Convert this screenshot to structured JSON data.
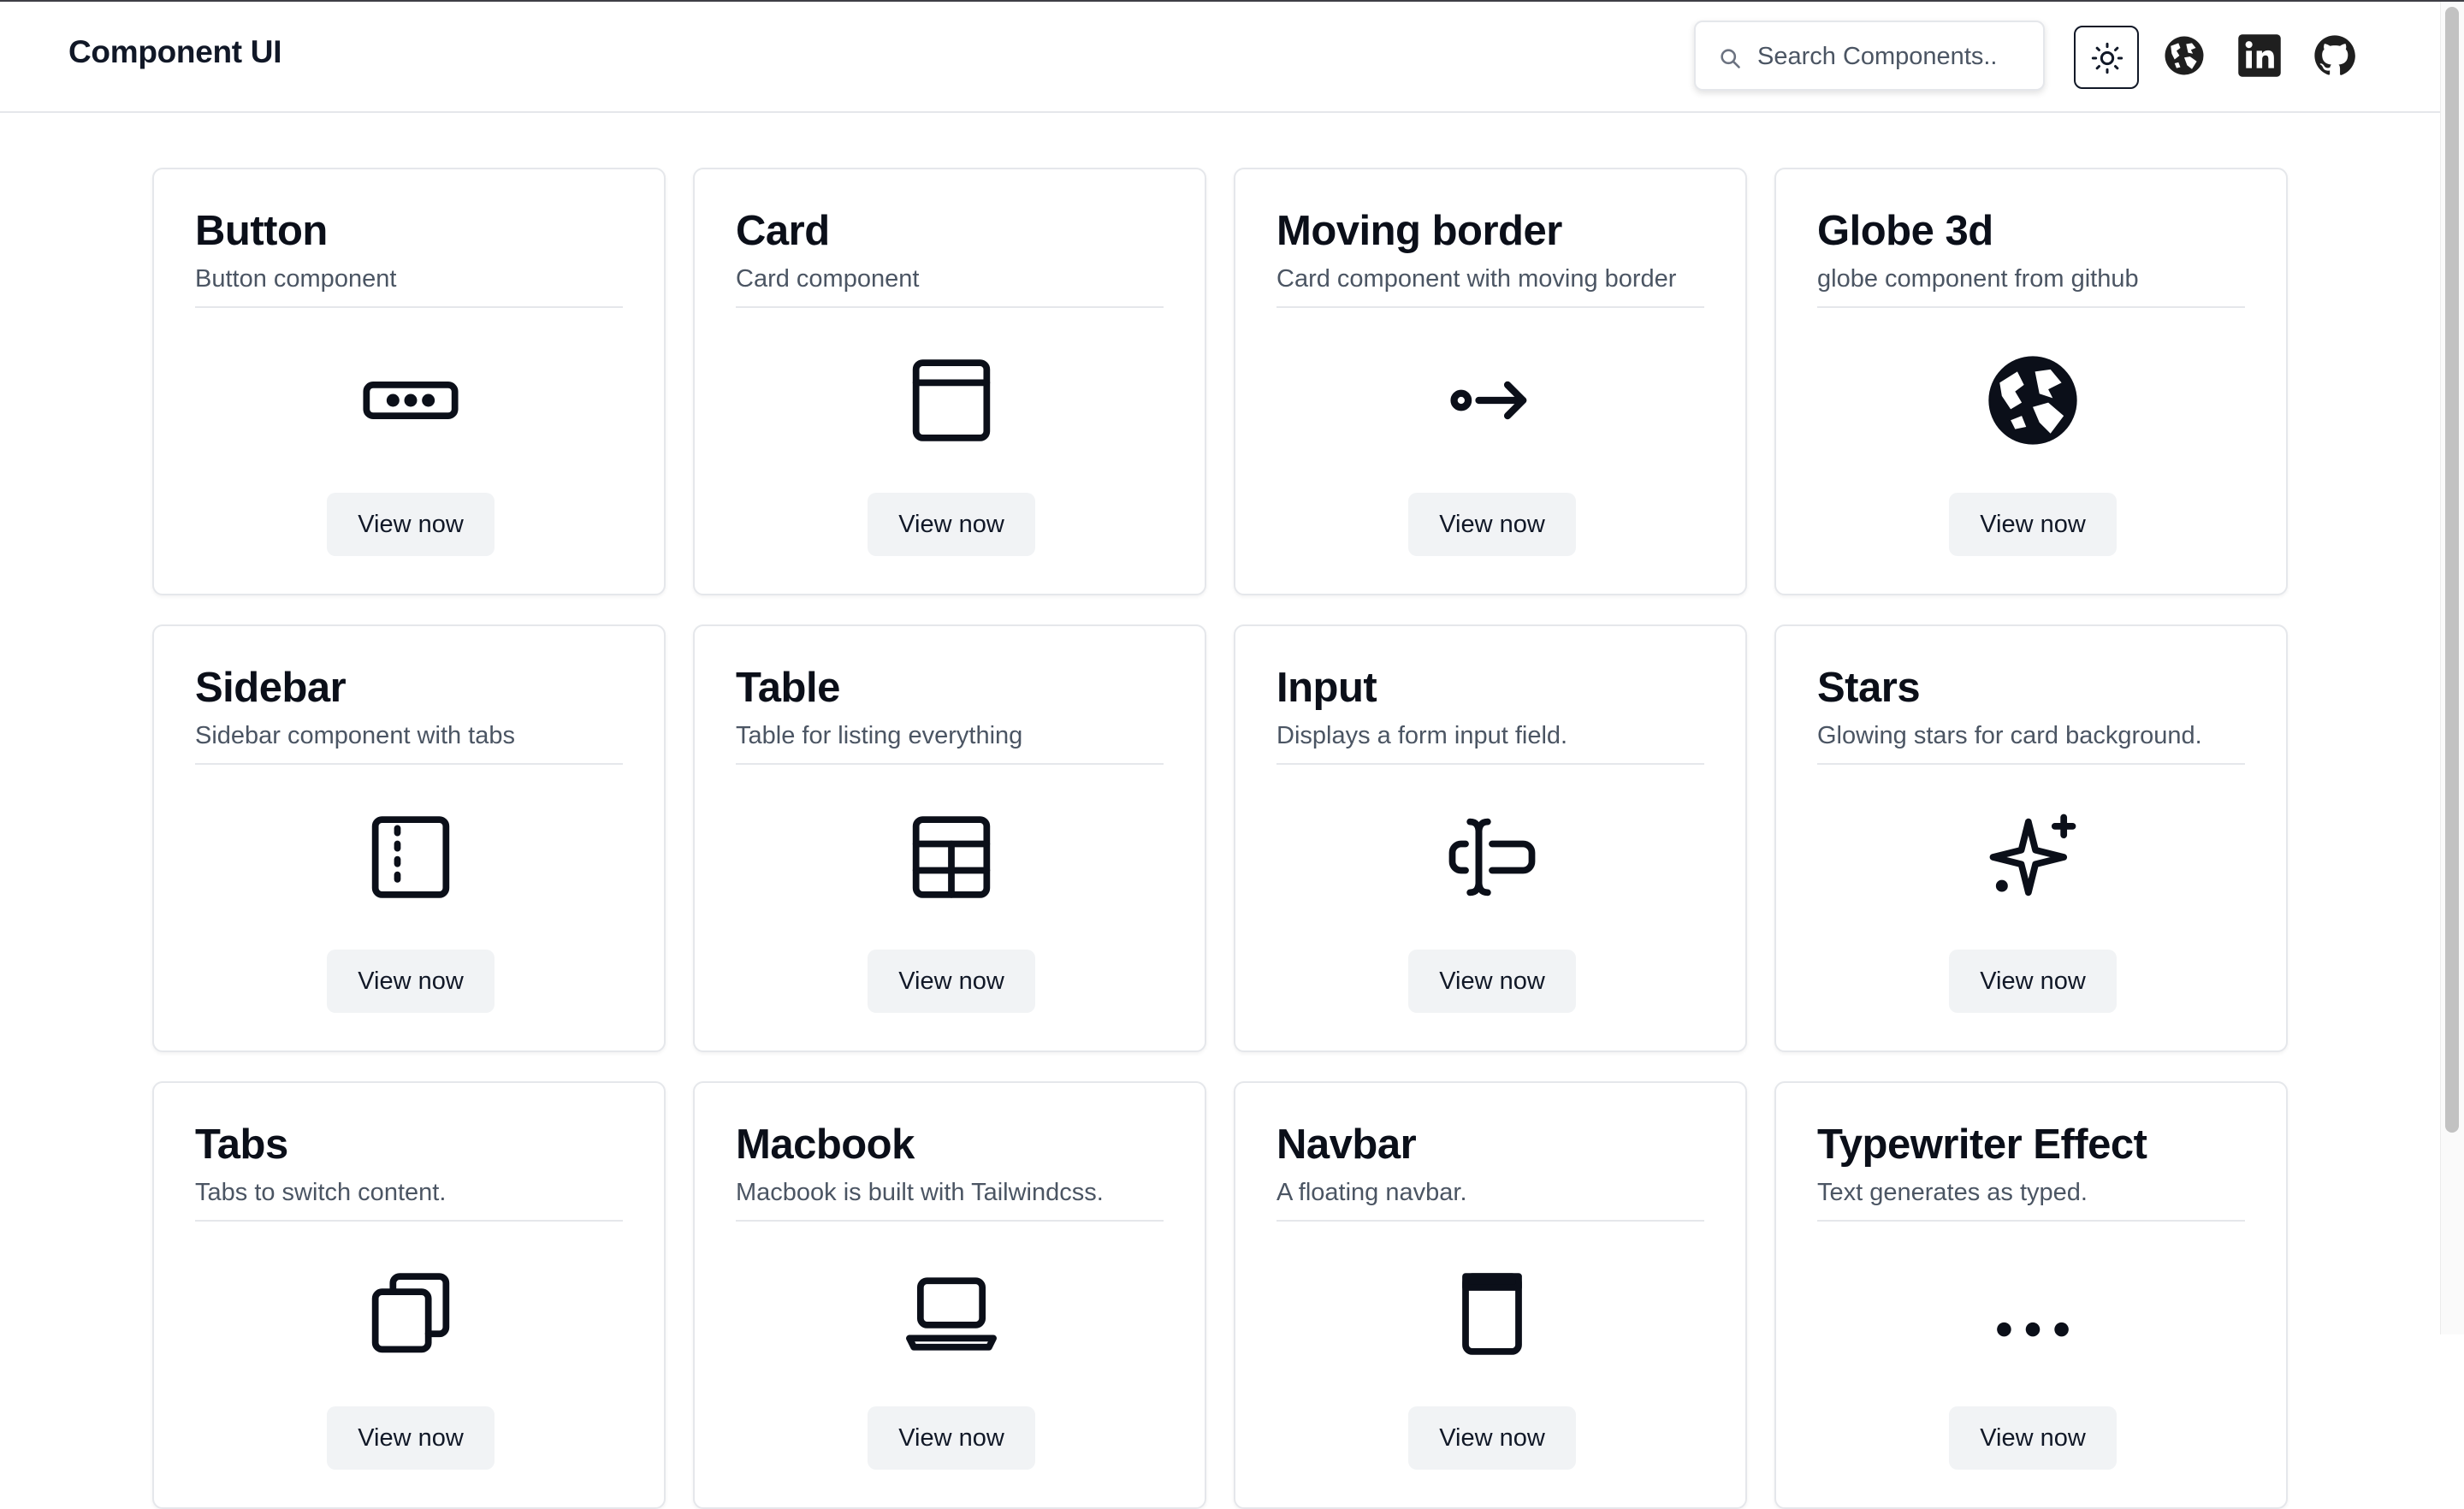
{
  "header": {
    "brand": "Component UI",
    "search_placeholder": "Search Components..",
    "theme_toggle": "sun-icon",
    "links": [
      "globe-icon",
      "linkedin-icon",
      "github-icon"
    ]
  },
  "cards": [
    {
      "title": "Button",
      "desc": "Button component",
      "icon": "button-icon",
      "cta": "View now"
    },
    {
      "title": "Card",
      "desc": "Card component",
      "icon": "card-icon",
      "cta": "View now"
    },
    {
      "title": "Moving border",
      "desc": "Card component with moving border",
      "icon": "arrow-icon",
      "cta": "View now"
    },
    {
      "title": "Globe 3d",
      "desc": "globe component from github",
      "icon": "globe-icon",
      "cta": "View now"
    },
    {
      "title": "Sidebar",
      "desc": "Sidebar component with tabs",
      "icon": "sidebar-icon",
      "cta": "View now"
    },
    {
      "title": "Table",
      "desc": "Table for listing everything",
      "icon": "table-icon",
      "cta": "View now"
    },
    {
      "title": "Input",
      "desc": "Displays a form input field.",
      "icon": "text-cursor-input-icon",
      "cta": "View now"
    },
    {
      "title": "Stars",
      "desc": "Glowing stars for card background.",
      "icon": "sparkles-icon",
      "cta": "View now"
    },
    {
      "title": "Tabs",
      "desc": "Tabs to switch content.",
      "icon": "tabs-icon",
      "cta": "View now"
    },
    {
      "title": "Macbook",
      "desc": "Macbook is built with Tailwindcss.",
      "icon": "laptop-icon",
      "cta": "View now"
    },
    {
      "title": "Navbar",
      "desc": "A floating navbar.",
      "icon": "navbar-icon",
      "cta": "View now"
    },
    {
      "title": "Typewriter Effect",
      "desc": "Text generates as typed.",
      "icon": "ellipsis-icon",
      "cta": "View now"
    }
  ]
}
